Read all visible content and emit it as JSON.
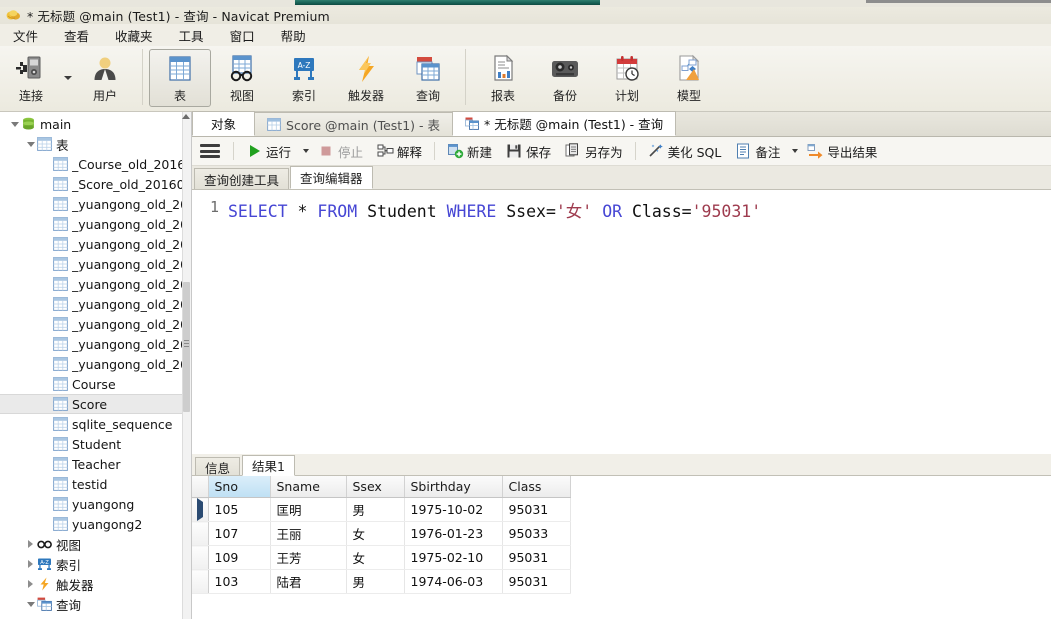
{
  "window": {
    "title": "* 无标题 @main (Test1) - 查询 - Navicat Premium",
    "app_icon": "navicat-logo-icon"
  },
  "menubar": {
    "items": [
      {
        "label": "文件",
        "name": "menu-file"
      },
      {
        "label": "查看",
        "name": "menu-view"
      },
      {
        "label": "收藏夹",
        "name": "menu-favorites"
      },
      {
        "label": "工具",
        "name": "menu-tools"
      },
      {
        "label": "窗口",
        "name": "menu-window"
      },
      {
        "label": "帮助",
        "name": "menu-help"
      }
    ]
  },
  "toolbar": {
    "buttons": [
      {
        "label": "连接",
        "icon": "connection-icon",
        "active": false,
        "has_dropdown": true
      },
      {
        "label": "用户",
        "icon": "user-icon",
        "active": false,
        "has_dropdown": false
      },
      {
        "label": "表",
        "icon": "table-icon",
        "active": true,
        "has_dropdown": false
      },
      {
        "label": "视图",
        "icon": "view-glasses-icon",
        "active": false,
        "has_dropdown": false
      },
      {
        "label": "索引",
        "icon": "index-az-icon",
        "active": false,
        "has_dropdown": false
      },
      {
        "label": "触发器",
        "icon": "trigger-lightning-icon",
        "active": false,
        "has_dropdown": false
      },
      {
        "label": "查询",
        "icon": "query-icon",
        "active": false,
        "has_dropdown": false
      },
      {
        "label": "报表",
        "icon": "report-icon",
        "active": false,
        "has_dropdown": false
      },
      {
        "label": "备份",
        "icon": "backup-tape-icon",
        "active": false,
        "has_dropdown": false
      },
      {
        "label": "计划",
        "icon": "schedule-calendar-clock-icon",
        "active": false,
        "has_dropdown": false
      },
      {
        "label": "模型",
        "icon": "model-diagram-icon",
        "active": false,
        "has_dropdown": false
      }
    ]
  },
  "sidebar": {
    "tree": [
      {
        "label": "main",
        "icon": "database-icon",
        "depth": 0,
        "expander": "down",
        "selected": false
      },
      {
        "label": "表",
        "icon": "table-folder-icon",
        "depth": 1,
        "expander": "down",
        "selected": false
      },
      {
        "label": "_Course_old_2016",
        "icon": "table-icon",
        "depth": 2,
        "expander": "none",
        "selected": false
      },
      {
        "label": "_Score_old_20160",
        "icon": "table-icon",
        "depth": 2,
        "expander": "none",
        "selected": false
      },
      {
        "label": "_yuangong_old_20",
        "icon": "table-icon",
        "depth": 2,
        "expander": "none",
        "selected": false
      },
      {
        "label": "_yuangong_old_20",
        "icon": "table-icon",
        "depth": 2,
        "expander": "none",
        "selected": false
      },
      {
        "label": "_yuangong_old_20",
        "icon": "table-icon",
        "depth": 2,
        "expander": "none",
        "selected": false
      },
      {
        "label": "_yuangong_old_20",
        "icon": "table-icon",
        "depth": 2,
        "expander": "none",
        "selected": false
      },
      {
        "label": "_yuangong_old_20",
        "icon": "table-icon",
        "depth": 2,
        "expander": "none",
        "selected": false
      },
      {
        "label": "_yuangong_old_20",
        "icon": "table-icon",
        "depth": 2,
        "expander": "none",
        "selected": false
      },
      {
        "label": "_yuangong_old_20",
        "icon": "table-icon",
        "depth": 2,
        "expander": "none",
        "selected": false
      },
      {
        "label": "_yuangong_old_20",
        "icon": "table-icon",
        "depth": 2,
        "expander": "none",
        "selected": false
      },
      {
        "label": "_yuangong_old_20",
        "icon": "table-icon",
        "depth": 2,
        "expander": "none",
        "selected": false
      },
      {
        "label": "Course",
        "icon": "table-icon",
        "depth": 2,
        "expander": "none",
        "selected": false
      },
      {
        "label": "Score",
        "icon": "table-icon",
        "depth": 2,
        "expander": "none",
        "selected": true
      },
      {
        "label": "sqlite_sequence",
        "icon": "table-icon",
        "depth": 2,
        "expander": "none",
        "selected": false
      },
      {
        "label": "Student",
        "icon": "table-icon",
        "depth": 2,
        "expander": "none",
        "selected": false
      },
      {
        "label": "Teacher",
        "icon": "table-icon",
        "depth": 2,
        "expander": "none",
        "selected": false
      },
      {
        "label": "testid",
        "icon": "table-icon",
        "depth": 2,
        "expander": "none",
        "selected": false
      },
      {
        "label": "yuangong",
        "icon": "table-icon",
        "depth": 2,
        "expander": "none",
        "selected": false
      },
      {
        "label": "yuangong2",
        "icon": "table-icon",
        "depth": 2,
        "expander": "none",
        "selected": false
      },
      {
        "label": "视图",
        "icon": "view-glasses-icon",
        "depth": 1,
        "expander": "right",
        "selected": false
      },
      {
        "label": "索引",
        "icon": "index-az-icon",
        "depth": 1,
        "expander": "right",
        "selected": false
      },
      {
        "label": "触发器",
        "icon": "trigger-lightning-icon",
        "depth": 1,
        "expander": "right",
        "selected": false
      },
      {
        "label": "查询",
        "icon": "query-icon",
        "depth": 1,
        "expander": "down",
        "selected": false
      }
    ]
  },
  "tabs": [
    {
      "label": "对象",
      "icon": "none",
      "active": false,
      "name": "tab-objects"
    },
    {
      "label": "Score @main (Test1) - 表",
      "icon": "table-icon",
      "active": false,
      "name": "tab-score-table"
    },
    {
      "label": "* 无标题 @main (Test1) - 查询",
      "icon": "query-icon",
      "active": true,
      "name": "tab-untitled-query"
    }
  ],
  "query_toolbar": {
    "menu_icon": "hamburger-menu-icon",
    "buttons": [
      {
        "label": "运行",
        "icon": "run-play-icon",
        "disabled": false,
        "dropdown": true,
        "name": "run-button"
      },
      {
        "label": "停止",
        "icon": "stop-square-icon",
        "disabled": true,
        "dropdown": false,
        "name": "stop-button"
      },
      {
        "label": "解释",
        "icon": "explain-icon",
        "disabled": false,
        "dropdown": false,
        "name": "explain-button"
      },
      {
        "label": "新建",
        "icon": "new-query-icon",
        "disabled": false,
        "dropdown": false,
        "name": "new-button"
      },
      {
        "label": "保存",
        "icon": "save-floppy-icon",
        "disabled": false,
        "dropdown": false,
        "name": "save-button"
      },
      {
        "label": "另存为",
        "icon": "save-as-icon",
        "disabled": false,
        "dropdown": false,
        "name": "save-as-button"
      },
      {
        "label": "美化 SQL",
        "icon": "beautify-sql-icon",
        "disabled": false,
        "dropdown": false,
        "name": "beautify-sql-button"
      },
      {
        "label": "备注",
        "icon": "note-icon",
        "disabled": false,
        "dropdown": true,
        "name": "note-button"
      },
      {
        "label": "导出结果",
        "icon": "export-arrow-icon",
        "disabled": false,
        "dropdown": false,
        "name": "export-result-button"
      }
    ]
  },
  "sub_tabs": [
    {
      "label": "查询创建工具",
      "active": false,
      "name": "subtab-query-builder"
    },
    {
      "label": "查询编辑器",
      "active": true,
      "name": "subtab-query-editor"
    }
  ],
  "editor": {
    "line_number": "1",
    "tokens": [
      {
        "t": "SELECT",
        "c": "kw"
      },
      {
        "t": " ",
        "c": "op"
      },
      {
        "t": "*",
        "c": "op"
      },
      {
        "t": " ",
        "c": "op"
      },
      {
        "t": "FROM",
        "c": "kw"
      },
      {
        "t": " ",
        "c": "op"
      },
      {
        "t": "Student",
        "c": "op"
      },
      {
        "t": " ",
        "c": "op"
      },
      {
        "t": "WHERE",
        "c": "kw"
      },
      {
        "t": " ",
        "c": "op"
      },
      {
        "t": "Ssex=",
        "c": "op"
      },
      {
        "t": "'女'",
        "c": "str"
      },
      {
        "t": " ",
        "c": "op"
      },
      {
        "t": "OR",
        "c": "kw"
      },
      {
        "t": " ",
        "c": "op"
      },
      {
        "t": "Class=",
        "c": "op"
      },
      {
        "t": "'95031'",
        "c": "str"
      }
    ],
    "full_text": "SELECT * FROM Student WHERE Ssex='女' OR Class='95031'"
  },
  "result_tabs": [
    {
      "label": "信息",
      "active": false,
      "name": "result-tab-info"
    },
    {
      "label": "结果1",
      "active": true,
      "name": "result-tab-result1"
    }
  ],
  "grid": {
    "columns": [
      {
        "label": "Sno",
        "width": 62,
        "highlighted": true
      },
      {
        "label": "Sname",
        "width": 76,
        "highlighted": false
      },
      {
        "label": "Ssex",
        "width": 58,
        "highlighted": false
      },
      {
        "label": "Sbirthday",
        "width": 98,
        "highlighted": false
      },
      {
        "label": "Class",
        "width": 68,
        "highlighted": false
      }
    ],
    "rows": [
      {
        "current": true,
        "cells": [
          "105",
          "匡明",
          "男",
          "1975-10-02",
          "95031"
        ]
      },
      {
        "current": false,
        "cells": [
          "107",
          "王丽",
          "女",
          "1976-01-23",
          "95033"
        ]
      },
      {
        "current": false,
        "cells": [
          "109",
          "王芳",
          "女",
          "1975-02-10",
          "95031"
        ]
      },
      {
        "current": false,
        "cells": [
          "103",
          "陆君",
          "男",
          "1974-06-03",
          "95031"
        ]
      }
    ]
  },
  "colors": {
    "accent_green": "#1f6b5e",
    "keyword_blue": "#4646d4",
    "string_red": "#9e3b4e",
    "header_highlight": "#bfe0f4"
  }
}
